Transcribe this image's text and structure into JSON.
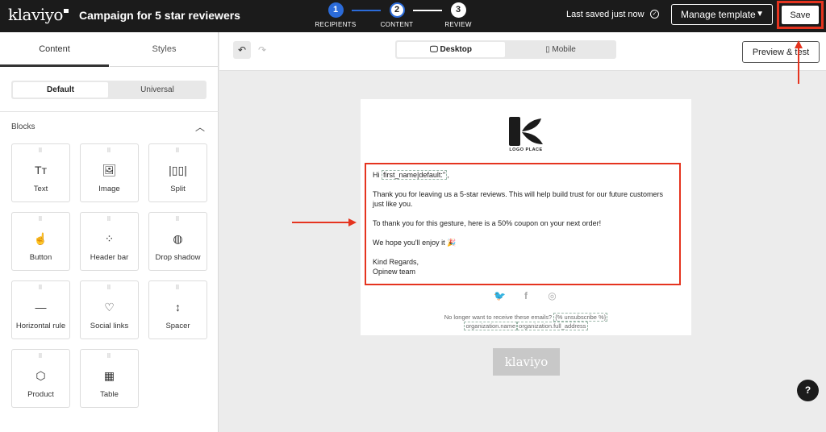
{
  "header": {
    "logo": "klaviyo",
    "campaign_title": "Campaign for 5 star reviewers",
    "steps": [
      {
        "num": "1",
        "label": "RECIPIENTS"
      },
      {
        "num": "2",
        "label": "CONTENT"
      },
      {
        "num": "3",
        "label": "REVIEW"
      }
    ],
    "last_saved": "Last saved just now",
    "manage_template": "Manage template",
    "save": "Save"
  },
  "left_panel": {
    "tabs": [
      "Content",
      "Styles"
    ],
    "segments": [
      "Default",
      "Universal"
    ],
    "blocks_title": "Blocks",
    "blocks": [
      {
        "label": "Text",
        "icon": "Tт"
      },
      {
        "label": "Image",
        "icon": "🖼"
      },
      {
        "label": "Split",
        "icon": "|▯▯|"
      },
      {
        "label": "Button",
        "icon": "☝"
      },
      {
        "label": "Header bar",
        "icon": "⁘"
      },
      {
        "label": "Drop shadow",
        "icon": "◍"
      },
      {
        "label": "Horizontal rule",
        "icon": "—"
      },
      {
        "label": "Social links",
        "icon": "♡"
      },
      {
        "label": "Spacer",
        "icon": "↕"
      },
      {
        "label": "Product",
        "icon": "⬡"
      },
      {
        "label": "Table",
        "icon": "▦"
      }
    ]
  },
  "toolbar": {
    "desktop": "Desktop",
    "mobile": "Mobile",
    "preview": "Preview & test"
  },
  "email": {
    "logo_text": "LOGO PLACE",
    "greeting_pre": "Hi ",
    "greeting_token": "first_name|default:''",
    "greeting_post": ",",
    "para1": "Thank you for leaving us a 5-star reviews. This will help build trust for our future customers just like you.",
    "para2": "To thank you for this gesture, here is a 50% coupon on your next order!",
    "para3": "We hope you'll enjoy it 🎉",
    "sign1": "Kind Regards,",
    "sign2": "Opinew team",
    "unsub_text": "No longer want to receive these emails?",
    "unsub_token": "{% unsubscribe %}",
    "org_name": "organization.name",
    "org_address": "organization.full_address",
    "footer_logo": "klaviyo"
  },
  "help": "?",
  "colors": {
    "accent": "#2b6bd9",
    "annotation": "#e5341f",
    "topbar": "#1b1b1b"
  }
}
